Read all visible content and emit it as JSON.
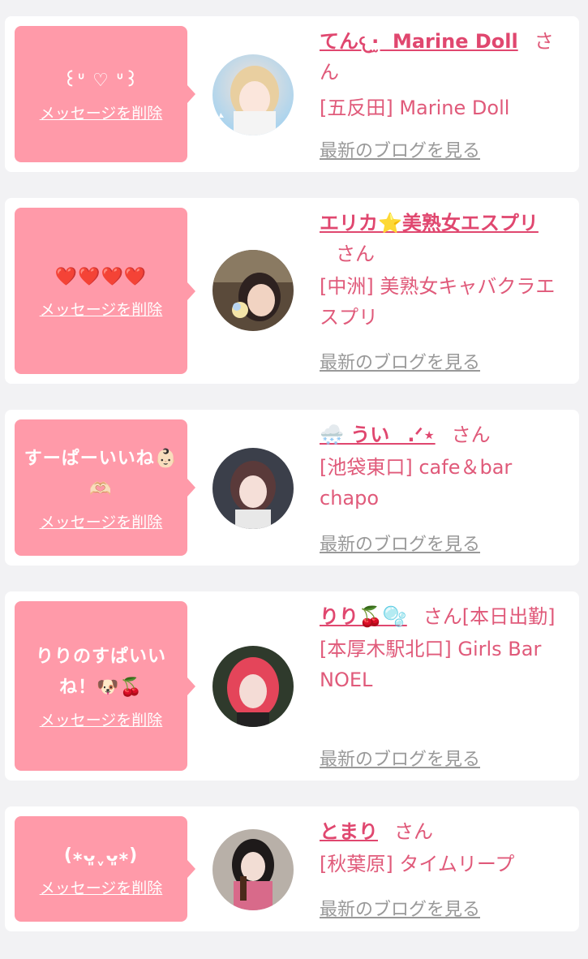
{
  "colors": {
    "page_bg": "#f2f2f4",
    "card_bg": "#ffffff",
    "bubble_bg": "#ff9aa9",
    "name_text": "#e0476f",
    "shop_text": "#e05a7a",
    "blog_link": "#999999"
  },
  "cards": [
    {
      "message": "꒰ᐡ ♡ ᐡ꒱",
      "delete_label": "メッセージを削除",
      "name": "てん𐔌·̫ ︎ Marine Doll",
      "honorific": "さん",
      "shop": "[五反田] Marine Doll",
      "blog_label": "最新のブログを見る"
    },
    {
      "message": "❤️❤️❤️❤️",
      "delete_label": "メッセージを削除",
      "name": "エリカ⭐️美熟女エスプリ",
      "honorific": "さん",
      "shop": "[中洲] 美熟女キャバクラエスプリ",
      "blog_label": "最新のブログを見る"
    },
    {
      "message": "すーぱーいいね👶🏻🫶🏻",
      "delete_label": "メッセージを削除",
      "name": "🌨️ ういㅤ.ᐟ⋆",
      "honorific": "さん",
      "shop": "[池袋東口] cafe＆bar chapo",
      "blog_label": "最新のブログを見る"
    },
    {
      "message": "りりのすぱいいね！🐶🍒",
      "delete_label": "メッセージを削除",
      "name": "りり🍒🫧",
      "honorific": "さん[本日出勤]",
      "shop": "[本厚木駅北口] Girls Bar NOEL",
      "blog_label": "最新のブログを見る"
    },
    {
      "message": "(⁎ᴗ͈ˬᴗ͈⁎)",
      "delete_label": "メッセージを削除",
      "name": "とまり",
      "honorific": "さん",
      "shop": "[秋葉原] タイムリープ",
      "blog_label": "最新のブログを見る"
    }
  ]
}
